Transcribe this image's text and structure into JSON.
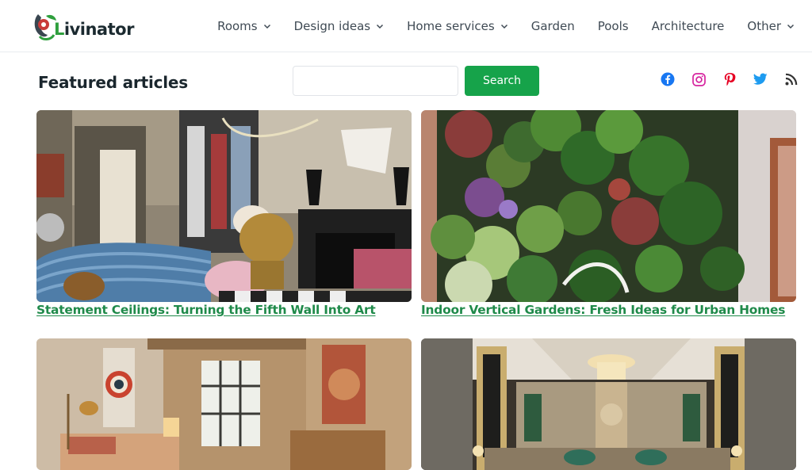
{
  "brand": {
    "logo_text_accent": "L",
    "logo_text_rest": "ivinator",
    "colors": {
      "accent_green": "#16a34a",
      "link_green": "#1f8a4a",
      "text_dark": "#1a262d"
    }
  },
  "nav": {
    "items": [
      {
        "label": "Rooms",
        "has_dropdown": true
      },
      {
        "label": "Design ideas",
        "has_dropdown": true
      },
      {
        "label": "Home services",
        "has_dropdown": true
      },
      {
        "label": "Garden",
        "has_dropdown": false
      },
      {
        "label": "Pools",
        "has_dropdown": false
      },
      {
        "label": "Architecture",
        "has_dropdown": false
      },
      {
        "label": "Other",
        "has_dropdown": true
      }
    ]
  },
  "featured": {
    "title": "Featured articles"
  },
  "search": {
    "value": "",
    "button_label": "Search"
  },
  "social": {
    "icons": [
      "facebook-icon",
      "instagram-icon",
      "pinterest-icon",
      "twitter-icon",
      "rss-icon"
    ],
    "colors": {
      "facebook": "#1877f2",
      "instagram": "#d6249f",
      "pinterest": "#e60023",
      "twitter": "#1d9bf0",
      "rss": "#333333"
    }
  },
  "articles": [
    {
      "title": "Statement Ceilings: Turning the Fifth Wall Into Art",
      "image": "living-room-blue-sofa-gold-bust-photo"
    },
    {
      "title": "Indoor Vertical Gardens: Fresh Ideas for Urban Homes",
      "image": "vertical-garden-wall-photo"
    },
    {
      "title": "",
      "image": "warm-living-room-target-art-photo"
    },
    {
      "title": "",
      "image": "art-deco-living-room-chandelier-photo"
    }
  ]
}
